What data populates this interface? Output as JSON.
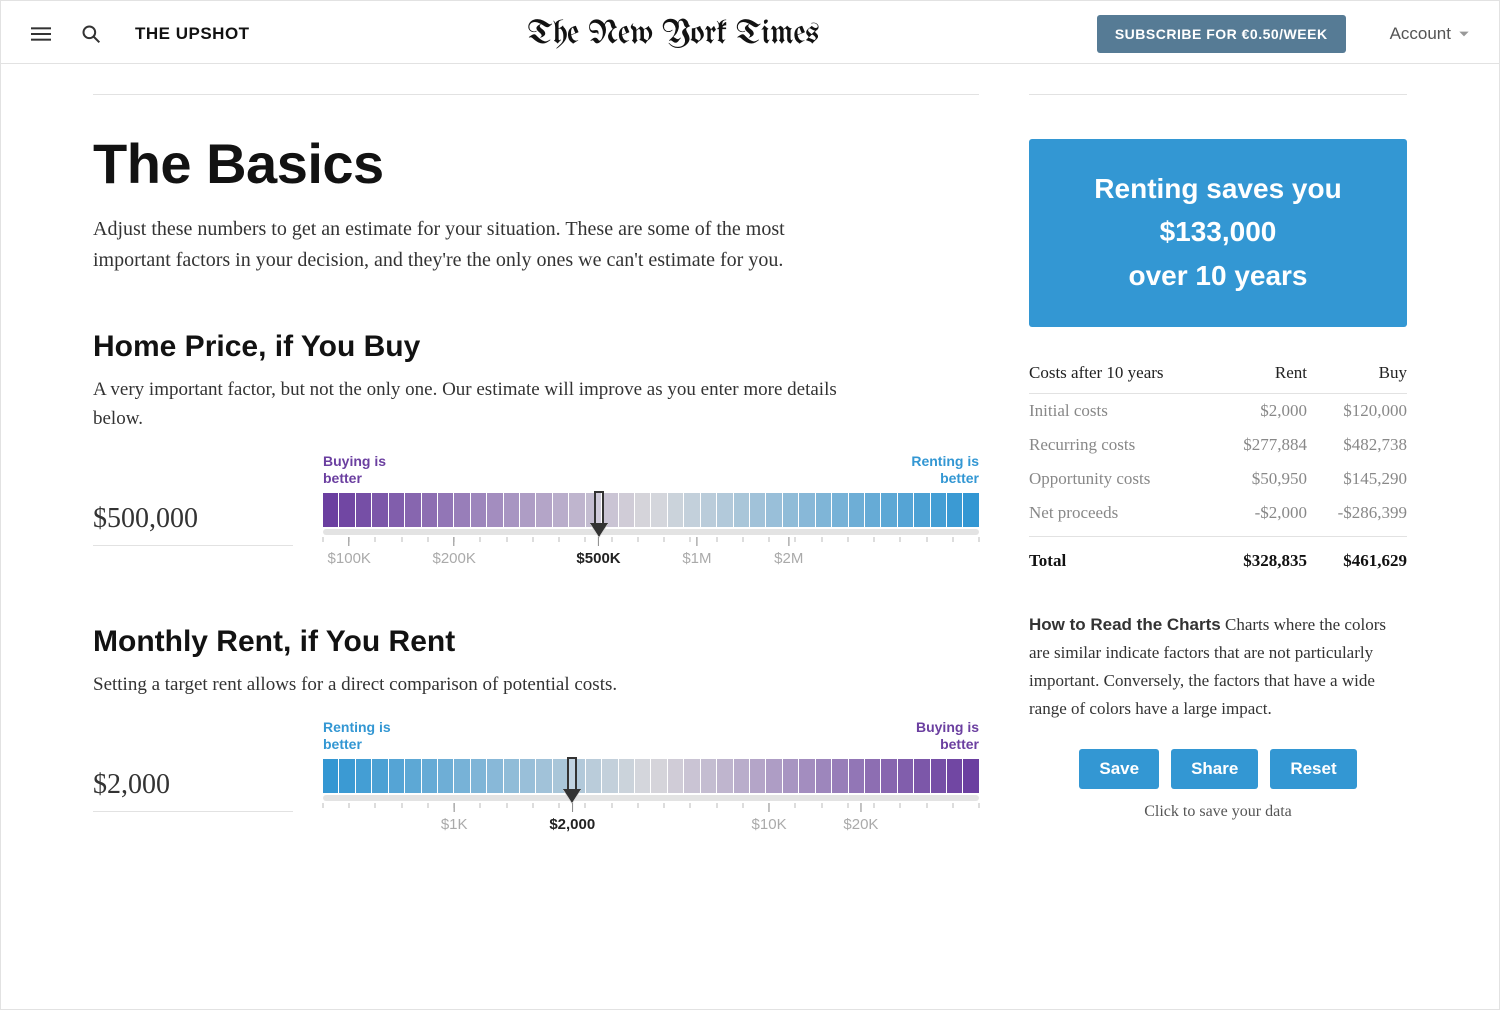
{
  "header": {
    "section": "THE UPSHOT",
    "logo": "The New York Times",
    "subscribe": "SUBSCRIBE FOR €0.50/WEEK",
    "account": "Account"
  },
  "main": {
    "title": "The Basics",
    "lead": "Adjust these numbers to get an estimate for your situation. These are some of the most important factors in your decision, and they're the only ones we can't estimate for you.",
    "sliders": {
      "home": {
        "heading": "Home Price, if You Buy",
        "sub": "A very important factor, but not the only one. Our estimate will improve as you enter more details below.",
        "left_label": "Buying is better",
        "right_label": "Renting is better",
        "value": "$500,000",
        "current_tick": "$500K",
        "handle_pct": 42,
        "ticks": [
          {
            "pos": 4,
            "label": "$100K",
            "minor": false
          },
          {
            "pos": 20,
            "label": "$200K",
            "minor": false
          },
          {
            "pos": 42,
            "label": "$500K",
            "minor": false,
            "current": true
          },
          {
            "pos": 57,
            "label": "$1M",
            "minor": false
          },
          {
            "pos": 71,
            "label": "$2M",
            "minor": false
          }
        ],
        "left_color": "purple",
        "right_color": "blue"
      },
      "rent": {
        "heading": "Monthly Rent, if You Rent",
        "sub": "Setting a target rent allows for a direct comparison of potential costs.",
        "left_label": "Renting is better",
        "right_label": "Buying is better",
        "value": "$2,000",
        "current_tick": "$2,000",
        "handle_pct": 38,
        "ticks": [
          {
            "pos": 20,
            "label": "$1K",
            "minor": false
          },
          {
            "pos": 38,
            "label": "$2,000",
            "minor": false,
            "current": true
          },
          {
            "pos": 68,
            "label": "$10K",
            "minor": false
          },
          {
            "pos": 82,
            "label": "$20K",
            "minor": false
          }
        ],
        "left_color": "blue",
        "right_color": "purple"
      }
    }
  },
  "side": {
    "summary": {
      "line1": "Renting saves you",
      "line2": "$133,000",
      "line3": "over 10 years"
    },
    "costs": {
      "header": {
        "title": "Costs after 10 years",
        "col_rent": "Rent",
        "col_buy": "Buy"
      },
      "rows": [
        {
          "label": "Initial costs",
          "rent": "$2,000",
          "buy": "$120,000"
        },
        {
          "label": "Recurring costs",
          "rent": "$277,884",
          "buy": "$482,738"
        },
        {
          "label": "Opportunity costs",
          "rent": "$50,950",
          "buy": "$145,290"
        },
        {
          "label": "Net proceeds",
          "rent": "-$2,000",
          "buy": "-$286,399"
        }
      ],
      "total": {
        "label": "Total",
        "rent": "$328,835",
        "buy": "$461,629"
      }
    },
    "howto": {
      "bold": "How to Read the Charts",
      "text": " Charts where the colors are similar indicate factors that are not particularly important. Conversely, the factors that have a wide range of colors have a large impact."
    },
    "buttons": {
      "save": "Save",
      "share": "Share",
      "reset": "Reset"
    },
    "save_note": "Click to save your data"
  },
  "chart_data": [
    {
      "type": "bar",
      "name": "Home Price slider gradient",
      "title": "Home Price, if You Buy",
      "xlabel": "Home price",
      "x_scale": "log",
      "x_ticks": [
        "$100K",
        "$200K",
        "$500K",
        "$1M",
        "$2M"
      ],
      "current_value": "$500,000",
      "handle_position_pct": 42,
      "left_meaning": "Buying is better",
      "right_meaning": "Renting is better",
      "left_color": "#6b3fa0",
      "right_color": "#3397d3",
      "segments": 40
    },
    {
      "type": "bar",
      "name": "Monthly Rent slider gradient",
      "title": "Monthly Rent, if You Rent",
      "xlabel": "Monthly rent",
      "x_scale": "log",
      "x_ticks": [
        "$1K",
        "$2,000",
        "$10K",
        "$20K"
      ],
      "current_value": "$2,000",
      "handle_position_pct": 38,
      "left_meaning": "Renting is better",
      "right_meaning": "Buying is better",
      "left_color": "#3397d3",
      "right_color": "#6b3fa0",
      "segments": 40
    },
    {
      "type": "table",
      "title": "Costs after 10 years",
      "columns": [
        "",
        "Rent",
        "Buy"
      ],
      "rows": [
        [
          "Initial costs",
          2000,
          120000
        ],
        [
          "Recurring costs",
          277884,
          482738
        ],
        [
          "Opportunity costs",
          50950,
          145290
        ],
        [
          "Net proceeds",
          -2000,
          -286399
        ],
        [
          "Total",
          328835,
          461629
        ]
      ]
    }
  ]
}
